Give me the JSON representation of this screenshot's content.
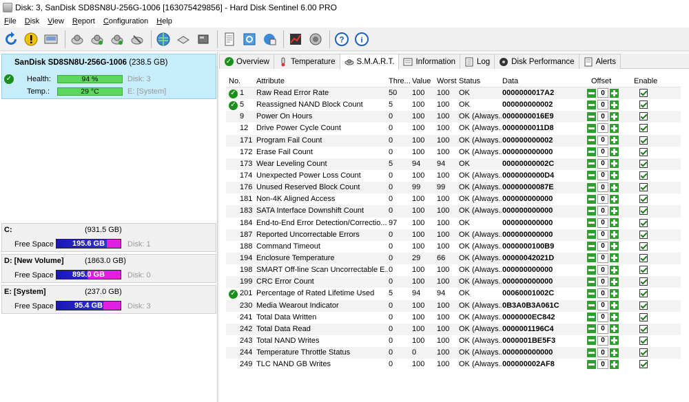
{
  "window": {
    "title": "Disk: 3, SanDisk SD8SN8U-256G-1006 [163075429856]  -  Hard Disk Sentinel 6.00 PRO"
  },
  "menu": [
    "File",
    "Disk",
    "View",
    "Report",
    "Configuration",
    "Help"
  ],
  "toolbar_icons": [
    "refresh-icon",
    "warning-icon",
    "disk-image-icon",
    "disk-test-icon",
    "disk-check-icon",
    "disk-verify-icon",
    "disk-repair-icon",
    "web-icon",
    "usb-drive-icon",
    "external-drive-icon",
    "report-icon",
    "sync-icon",
    "network-icon",
    "chart-icon",
    "sound-icon",
    "help-icon",
    "info-icon"
  ],
  "disk": {
    "name": "SanDisk SD8SN8U-256G-1006",
    "size": "(238.5 GB)",
    "health_label": "Health:",
    "health_value": "94 %",
    "health_percent": 94,
    "disk_index": "Disk: 3",
    "temp_label": "Temp.:",
    "temp_value": "29 °C",
    "volume": "E: [System]"
  },
  "volumes": [
    {
      "name": "C:",
      "size": "(931.5 GB)",
      "free_label": "Free Space",
      "free": "195.6 GB",
      "used_fraction": 0.21,
      "disk": "Disk: 1"
    },
    {
      "name": "D: [New Volume]",
      "size": "(1863.0 GB)",
      "free_label": "Free Space",
      "free": "895.0 GB",
      "used_fraction": 0.52,
      "disk": "Disk: 0"
    },
    {
      "name": "E: [System]",
      "size": "(237.0 GB)",
      "free_label": "Free Space",
      "free": "95.4 GB",
      "used_fraction": 0.27,
      "disk": "Disk: 3"
    }
  ],
  "tabs": [
    {
      "label": "Overview",
      "icon": "ok-icon"
    },
    {
      "label": "Temperature",
      "icon": "thermometer-icon"
    },
    {
      "label": "S.M.A.R.T.",
      "icon": "smart-icon",
      "active": true
    },
    {
      "label": "Information",
      "icon": "information-icon"
    },
    {
      "label": "Log",
      "icon": "log-icon"
    },
    {
      "label": "Disk Performance",
      "icon": "performance-icon"
    },
    {
      "label": "Alerts",
      "icon": "alerts-icon"
    }
  ],
  "smart": {
    "headers": {
      "no": "No.",
      "attribute": "Attribute",
      "threshold": "Thre...",
      "value": "Value",
      "worst": "Worst",
      "status": "Status",
      "data": "Data",
      "offset": "Offset",
      "enable": "Enable"
    },
    "rows": [
      {
        "ok": true,
        "no": "1",
        "attr": "Raw Read Error Rate",
        "th": "50",
        "val": "100",
        "worst": "100",
        "status": "OK",
        "data": "0000000017A2",
        "offset": "0"
      },
      {
        "ok": true,
        "no": "5",
        "attr": "Reassigned NAND Block Count",
        "th": "5",
        "val": "100",
        "worst": "100",
        "status": "OK",
        "data": "000000000002",
        "offset": "0"
      },
      {
        "ok": false,
        "no": "9",
        "attr": "Power On Hours",
        "th": "0",
        "val": "100",
        "worst": "100",
        "status": "OK (Always...",
        "data": "0000000016E9",
        "offset": "0"
      },
      {
        "ok": false,
        "no": "12",
        "attr": "Drive Power Cycle Count",
        "th": "0",
        "val": "100",
        "worst": "100",
        "status": "OK (Always...",
        "data": "0000000011D8",
        "offset": "0"
      },
      {
        "ok": false,
        "no": "171",
        "attr": "Program Fail Count",
        "th": "0",
        "val": "100",
        "worst": "100",
        "status": "OK (Always...",
        "data": "000000000002",
        "offset": "0"
      },
      {
        "ok": false,
        "no": "172",
        "attr": "Erase Fail Count",
        "th": "0",
        "val": "100",
        "worst": "100",
        "status": "OK (Always...",
        "data": "000000000000",
        "offset": "0"
      },
      {
        "ok": false,
        "no": "173",
        "attr": "Wear Leveling Count",
        "th": "5",
        "val": "94",
        "worst": "94",
        "status": "OK",
        "data": "00000000002C",
        "offset": "0"
      },
      {
        "ok": false,
        "no": "174",
        "attr": "Unexpected Power Loss Count",
        "th": "0",
        "val": "100",
        "worst": "100",
        "status": "OK (Always...",
        "data": "0000000000D4",
        "offset": "0"
      },
      {
        "ok": false,
        "no": "176",
        "attr": "Unused Reserved Block Count",
        "th": "0",
        "val": "99",
        "worst": "99",
        "status": "OK (Always...",
        "data": "00000000087E",
        "offset": "0"
      },
      {
        "ok": false,
        "no": "181",
        "attr": "Non-4K Aligned Access",
        "th": "0",
        "val": "100",
        "worst": "100",
        "status": "OK (Always...",
        "data": "000000000000",
        "offset": "0"
      },
      {
        "ok": false,
        "no": "183",
        "attr": "SATA Interface Downshift Count",
        "th": "0",
        "val": "100",
        "worst": "100",
        "status": "OK (Always...",
        "data": "000000000000",
        "offset": "0"
      },
      {
        "ok": false,
        "no": "184",
        "attr": "End-to-End Error Detection/Correctio...",
        "th": "97",
        "val": "100",
        "worst": "100",
        "status": "OK",
        "data": "000000000000",
        "offset": "0"
      },
      {
        "ok": false,
        "no": "187",
        "attr": "Reported Uncorrectable Errors",
        "th": "0",
        "val": "100",
        "worst": "100",
        "status": "OK (Always...",
        "data": "000000000000",
        "offset": "0"
      },
      {
        "ok": false,
        "no": "188",
        "attr": "Command Timeout",
        "th": "0",
        "val": "100",
        "worst": "100",
        "status": "OK (Always...",
        "data": "0000000100B9",
        "offset": "0"
      },
      {
        "ok": false,
        "no": "194",
        "attr": "Enclosure Temperature",
        "th": "0",
        "val": "29",
        "worst": "66",
        "status": "OK (Always...",
        "data": "00000042021D",
        "offset": "0"
      },
      {
        "ok": false,
        "no": "198",
        "attr": "SMART Off-line Scan Uncorrectable E...",
        "th": "0",
        "val": "100",
        "worst": "100",
        "status": "OK (Always...",
        "data": "000000000000",
        "offset": "0"
      },
      {
        "ok": false,
        "no": "199",
        "attr": "CRC Error Count",
        "th": "0",
        "val": "100",
        "worst": "100",
        "status": "OK (Always...",
        "data": "000000000000",
        "offset": "0"
      },
      {
        "ok": true,
        "no": "201",
        "attr": "Percentage of Rated Lifetime Used",
        "th": "5",
        "val": "94",
        "worst": "94",
        "status": "OK",
        "data": "00060001002C",
        "offset": "0"
      },
      {
        "ok": false,
        "no": "230",
        "attr": "Media Wearout Indicator",
        "th": "0",
        "val": "100",
        "worst": "100",
        "status": "OK (Always...",
        "data": "0B3A0B3A061C",
        "offset": "0"
      },
      {
        "ok": false,
        "no": "241",
        "attr": "Total Data Written",
        "th": "0",
        "val": "100",
        "worst": "100",
        "status": "OK (Always...",
        "data": "0000000EC842",
        "offset": "0"
      },
      {
        "ok": false,
        "no": "242",
        "attr": "Total Data Read",
        "th": "0",
        "val": "100",
        "worst": "100",
        "status": "OK (Always...",
        "data": "0000001196C4",
        "offset": "0"
      },
      {
        "ok": false,
        "no": "243",
        "attr": "Total NAND Writes",
        "th": "0",
        "val": "100",
        "worst": "100",
        "status": "OK (Always...",
        "data": "0000001BE5F3",
        "offset": "0"
      },
      {
        "ok": false,
        "no": "244",
        "attr": "Temperature Throttle Status",
        "th": "0",
        "val": "0",
        "worst": "100",
        "status": "OK (Always...",
        "data": "000000000000",
        "offset": "0"
      },
      {
        "ok": false,
        "no": "249",
        "attr": "TLC NAND GB Writes",
        "th": "0",
        "val": "100",
        "worst": "100",
        "status": "OK (Always...",
        "data": "000000002AF8",
        "offset": "0"
      }
    ]
  },
  "colors": {
    "selected_disk_bg": "#c7ecfa",
    "health_bar": "#5cd65c",
    "free_space_bar": "#1a18b8",
    "used_space_bar": "#e020e0",
    "ok_green": "#1a8f1a"
  }
}
